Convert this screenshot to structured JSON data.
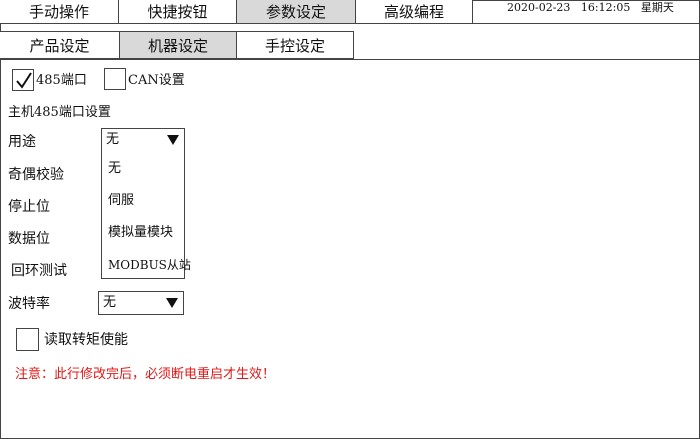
{
  "top_tabs": [
    {
      "label": "手动操作",
      "active": false
    },
    {
      "label": "快捷按钮",
      "active": false
    },
    {
      "label": "参数设定",
      "active": true
    },
    {
      "label": "高级编程",
      "active": false
    }
  ],
  "datetime": {
    "date": "2020-02-23",
    "time": "16:12:05",
    "weekday": "星期天"
  },
  "sub_tabs": [
    {
      "label": "产品设定",
      "active": false
    },
    {
      "label": "机器设定",
      "active": true
    },
    {
      "label": "手控设定",
      "active": false
    }
  ],
  "ports": {
    "rs485": {
      "label": "485端口",
      "checked": true
    },
    "can": {
      "label": "CAN设置",
      "checked": false
    }
  },
  "section_title": "主机485端口设置",
  "fields": {
    "usage": {
      "label": "用途",
      "value": "无",
      "options": [
        "无",
        "伺服",
        "模拟量模块",
        "MODBUS从站"
      ]
    },
    "parity": {
      "label": "奇偶校验"
    },
    "stop_bits": {
      "label": "停止位"
    },
    "data_bits": {
      "label": "数据位"
    },
    "loopback": {
      "label": "回环测试"
    },
    "baud_rate": {
      "label": "波特率",
      "value": "无"
    }
  },
  "read_torque": {
    "label": "读取转矩使能",
    "checked": false
  },
  "notice": "注意：此行修改完后，必须断电重启才生效！",
  "colors": {
    "active_tab": "#d9d9d9",
    "notice": "#e01818",
    "border": "#444444"
  }
}
